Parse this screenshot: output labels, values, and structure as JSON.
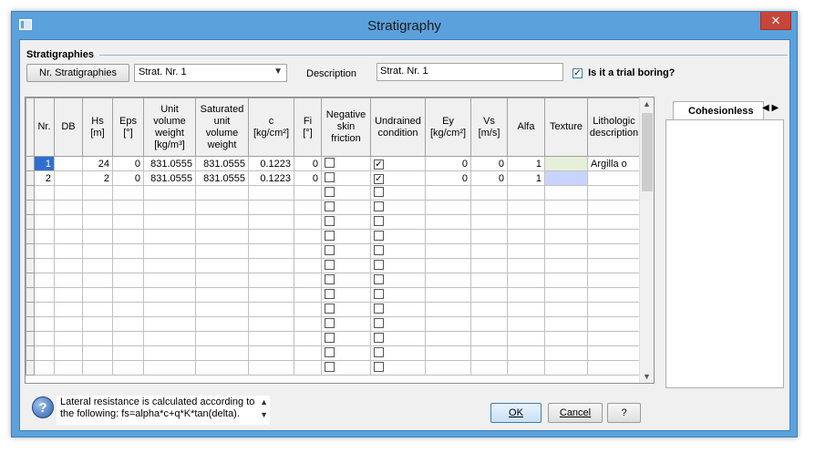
{
  "window": {
    "title": "Stratigraphy",
    "close_label": "✕"
  },
  "group": {
    "label": "Stratigraphies"
  },
  "toolbar": {
    "nr_button": "Nr. Stratigraphies",
    "combo_value": "Strat. Nr. 1",
    "description_label": "Description",
    "description_value": "Strat. Nr. 1",
    "trial_label": "Is it a trial boring?",
    "trial_checked": "✓"
  },
  "columns": [
    "Nr.",
    "DB",
    "Hs\n[m]",
    "Eps\n[°]",
    "Unit\nvolume\nweight\n[kg/m³]",
    "Saturated\nunit\nvolume\nweight",
    "c\n[kg/cm²]",
    "Fi\n[°]",
    "Negative\nskin\nfriction",
    "Undrained\ncondition",
    "Ey\n[kg/cm²]",
    "Vs\n[m/s]",
    "Alfa",
    "Texture",
    "Lithologic\ndescription"
  ],
  "rows": [
    {
      "nr": "1",
      "db": "",
      "hs": "24",
      "eps": "0",
      "uvw": "831.0555",
      "suvw": "831.0555",
      "c": "0.1223",
      "fi": "0",
      "neg": "",
      "undr": "✓",
      "ey": "0",
      "vs": "0",
      "alfa": "1",
      "texture_color": "#e6f0d9",
      "litho": "Argilla o"
    },
    {
      "nr": "2",
      "db": "",
      "hs": "2",
      "eps": "0",
      "uvw": "831.0555",
      "suvw": "831.0555",
      "c": "0.1223",
      "fi": "0",
      "neg": "",
      "undr": "✓",
      "ey": "0",
      "vs": "0",
      "alfa": "1",
      "texture_color": "#c8d4ff",
      "litho": ""
    }
  ],
  "right_panel": {
    "tab_label": "Cohesionless",
    "nav_prev": "◀",
    "nav_next": "▶"
  },
  "info": {
    "text": "Lateral resistance is calculated according to the following: fs=alpha*c+q*K*tan(delta)."
  },
  "buttons": {
    "ok": "OK",
    "cancel": "Cancel",
    "help": "?"
  },
  "icons": {
    "help": "question-icon",
    "window": "window-icon"
  },
  "colors": {
    "titlebar": "#5ba1dc",
    "close": "#c7453a",
    "selected_row_marker": "#2f6ed1"
  }
}
